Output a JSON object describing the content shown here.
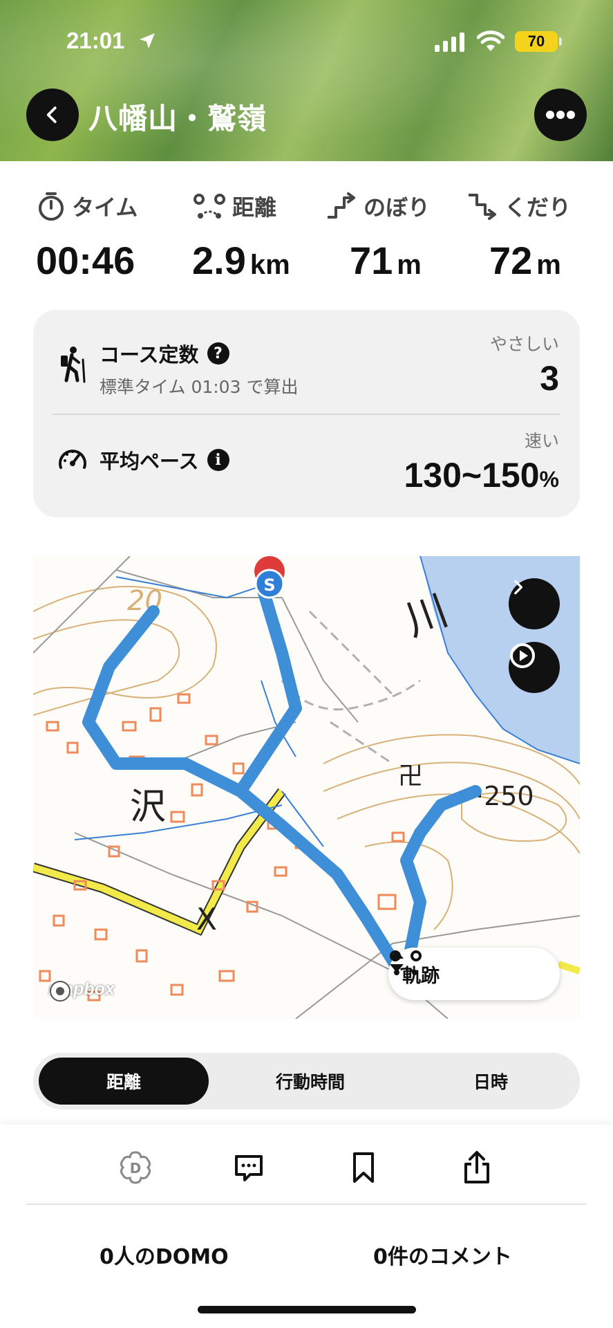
{
  "status_bar": {
    "time": "21:01",
    "battery": "70",
    "battery_color": "#f5d21b"
  },
  "header": {
    "title": "八幡山・鷲嶺",
    "back_icon": "chevron-left-icon",
    "more_icon": "more-horizontal-icon"
  },
  "stats": [
    {
      "icon": "stopwatch-icon",
      "label": "タイム",
      "value": "00:46",
      "unit": ""
    },
    {
      "icon": "route-icon",
      "label": "距離",
      "value": "2.9",
      "unit": "km"
    },
    {
      "icon": "ascent-icon",
      "label": "のぼり",
      "value": "71",
      "unit": "m"
    },
    {
      "icon": "descent-icon",
      "label": "くだり",
      "value": "72",
      "unit": "m"
    }
  ],
  "course": {
    "title": "コース定数",
    "help_icon": "question-icon",
    "subtitle": "標準タイム 01:03 で算出",
    "difficulty_label": "やさしい",
    "value": "3"
  },
  "pace": {
    "title": "平均ペース",
    "info_icon": "info-icon",
    "speed_label": "速い",
    "value": "130~150",
    "unit": "%"
  },
  "map": {
    "labels": {
      "kanji_sawa": "沢",
      "contour_20": "20",
      "elevation_250": "·250",
      "river": "川",
      "map_symbol": "卍"
    },
    "track_toggle_label": "軌跡",
    "attribution": "mapbox",
    "start_marker": "S",
    "route_color": "#3f8fd8"
  },
  "tabs": [
    {
      "label": "距離",
      "active": true
    },
    {
      "label": "行動時間",
      "active": false
    },
    {
      "label": "日時",
      "active": false
    }
  ],
  "actions": {
    "domo_icon": "domo-flower-icon",
    "comment_icon": "comment-icon",
    "bookmark_icon": "bookmark-icon",
    "share_icon": "share-icon"
  },
  "counts": {
    "domo": "0人のDOMO",
    "comments": "0件のコメント"
  }
}
